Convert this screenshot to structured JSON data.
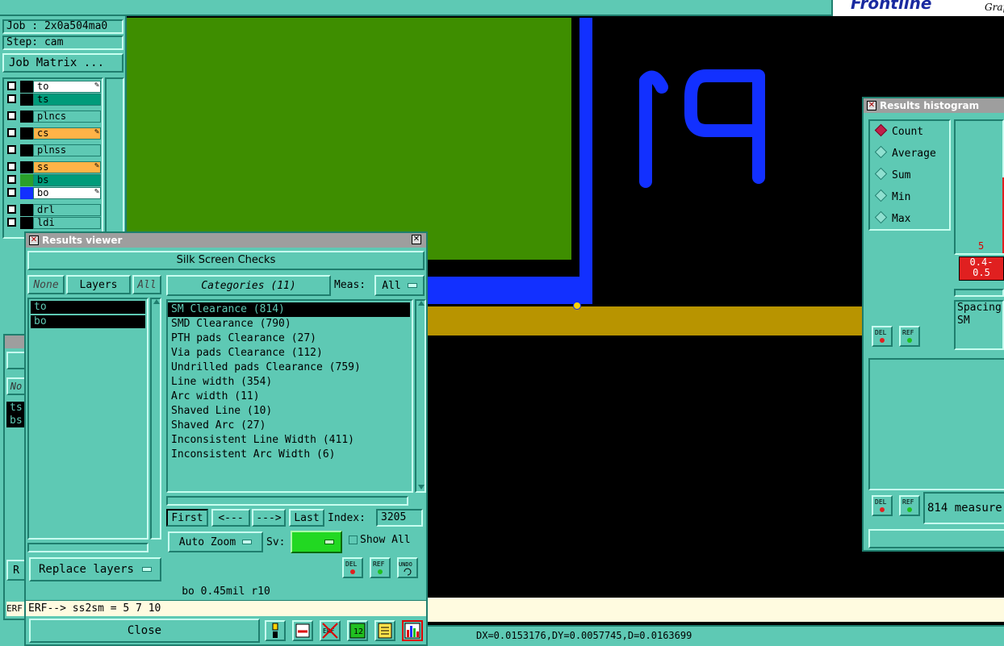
{
  "job_panel": {
    "job": "Job : 2x0a504ma0",
    "step": "Step: cam",
    "matrix_button": "Job Matrix ..."
  },
  "layers": [
    {
      "name": "to",
      "bg": "#ffffff",
      "sq": "#000000",
      "flag": true
    },
    {
      "name": "ts",
      "bg": "#009b7a",
      "sq": "#000000",
      "flag": false
    },
    {
      "name": "plncs",
      "bg": "#5ec9b4",
      "sq": "#000000",
      "flag": false
    },
    {
      "name": "cs",
      "bg": "#ffb347",
      "sq": "#000000",
      "flag": true
    },
    {
      "name": "plnss",
      "bg": "#5ec9b4",
      "sq": "#000000",
      "flag": false
    },
    {
      "name": "ss",
      "bg": "#ffb347",
      "sq": "#000000",
      "flag": true
    },
    {
      "name": "bs",
      "bg": "#009b7a",
      "sq": "#2aa02a",
      "flag": false
    },
    {
      "name": "bo",
      "bg": "#ffffff",
      "sq": "#1230ff",
      "flag": true
    },
    {
      "name": "drl",
      "bg": "#5ec9b4",
      "sq": "#000000",
      "flag": false
    },
    {
      "name": "ldi",
      "bg": "#5ec9b4",
      "sq": "#000000",
      "flag": false
    }
  ],
  "canvas": {
    "silk_text": "P1",
    "status": "DX=0.0153176,DY=0.0057745,D=0.0163699",
    "brand": "Frontline",
    "brand_sub": "Grap"
  },
  "results_viewer": {
    "title": "Results viewer",
    "header": "Silk Screen Checks",
    "none_label": "None",
    "layers_label": "Layers",
    "all_label": "All",
    "categories_label": "Categories (11)",
    "meas_label": "Meas:",
    "meas_value": "All",
    "layer_list": [
      "to",
      "bo"
    ],
    "categories": [
      "SM Clearance (814)",
      "SMD Clearance (790)",
      "PTH pads Clearance (27)",
      "Via pads Clearance (112)",
      "Undrilled pads Clearance (759)",
      "Line width (354)",
      "Arc width (11)",
      "Shaved Line (10)",
      "Shaved Arc (27)",
      "Inconsistent Line Width (411)",
      "Inconsistent Arc Width (6)"
    ],
    "first": "First",
    "prev": "<---",
    "next": "--->",
    "last": "Last",
    "index_label": "Index:",
    "index_value": "3205",
    "auto_zoom": "Auto Zoom",
    "sv_label": "Sv:",
    "show_all": "Show All",
    "replace_layers": "Replace layers",
    "del": "DEL",
    "ref": "REF",
    "undo": "UNDO",
    "info": "bo 0.45mil  r10",
    "erf": "ERF--> ss2sm = 5 7 10",
    "close": "Close"
  },
  "histogram": {
    "title": "Results histogram",
    "options": [
      "Count",
      "Average",
      "Sum",
      "Min",
      "Max"
    ],
    "selected": "Count",
    "bar_count": "5",
    "bar_range": "0.4-\n0.5",
    "legend_line1": "Spacing",
    "legend_line2": "SM",
    "del": "DEL",
    "ref": "REF",
    "measures": "814 measure"
  },
  "left_partial": {
    "no": "No",
    "ts": "ts",
    "bs": "bs",
    "r": "R",
    "erf": "ERF"
  }
}
